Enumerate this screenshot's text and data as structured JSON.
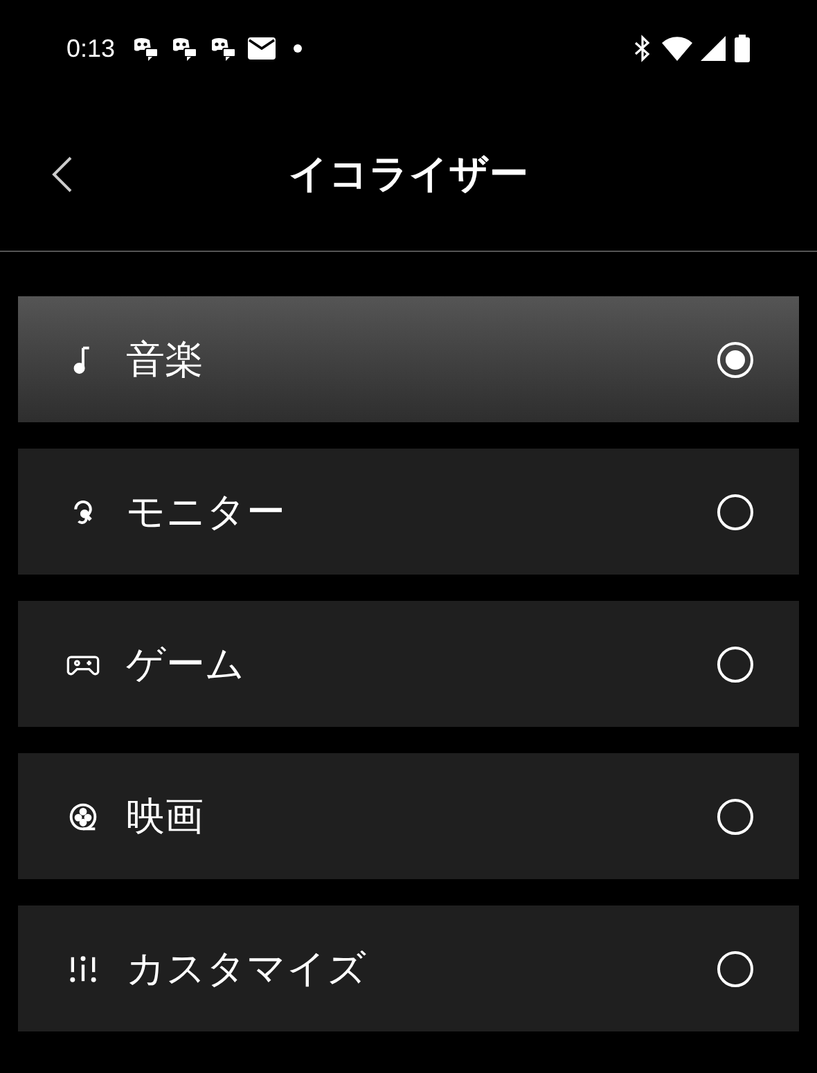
{
  "status_bar": {
    "time": "0:13"
  },
  "header": {
    "title": "イコライザー"
  },
  "presets": [
    {
      "kind": "music",
      "label": "音楽",
      "selected": true
    },
    {
      "kind": "monitor",
      "label": "モニター",
      "selected": false
    },
    {
      "kind": "game",
      "label": "ゲーム",
      "selected": false
    },
    {
      "kind": "movie",
      "label": "映画",
      "selected": false
    },
    {
      "kind": "custom",
      "label": "カスタマイズ",
      "selected": false
    }
  ]
}
